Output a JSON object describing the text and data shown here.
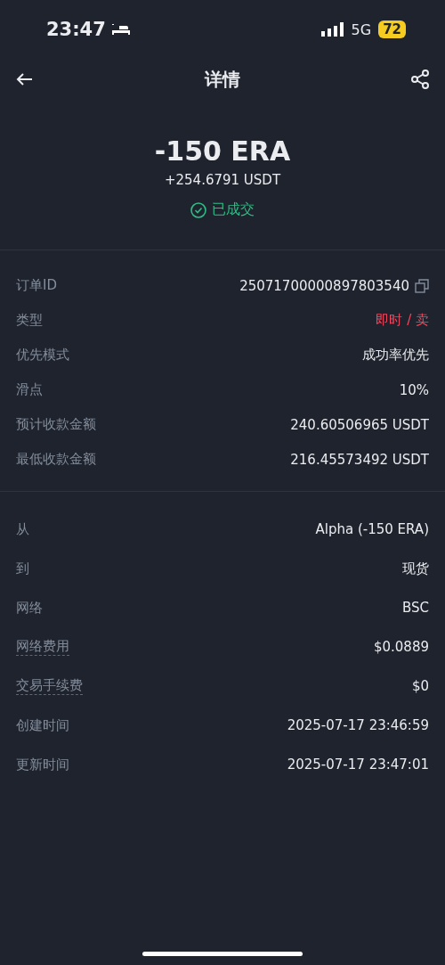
{
  "status_bar": {
    "time": "23:47",
    "network": "5G",
    "battery": "72"
  },
  "header": {
    "title": "详情"
  },
  "summary": {
    "amount": "-150 ERA",
    "received": "+254.6791 USDT",
    "status": "已成交"
  },
  "sections": [
    {
      "rows": [
        {
          "label": "订单ID",
          "value": "25071700000897803540",
          "copyable": true,
          "underlined": false,
          "sell": false
        },
        {
          "label": "类型",
          "value": "即时 / 卖",
          "copyable": false,
          "underlined": false,
          "sell": true
        },
        {
          "label": "优先模式",
          "value": "成功率优先",
          "copyable": false,
          "underlined": false,
          "sell": false
        },
        {
          "label": "滑点",
          "value": "10%",
          "copyable": false,
          "underlined": false,
          "sell": false
        },
        {
          "label": "预计收款金额",
          "value": "240.60506965 USDT",
          "copyable": false,
          "underlined": false,
          "sell": false
        },
        {
          "label": "最低收款金额",
          "value": "216.45573492 USDT",
          "copyable": false,
          "underlined": false,
          "sell": false
        }
      ]
    },
    {
      "rows": [
        {
          "label": "从",
          "value": "Alpha (-150 ERA)",
          "copyable": false,
          "underlined": false,
          "sell": false
        },
        {
          "label": "到",
          "value": "现货",
          "copyable": false,
          "underlined": false,
          "sell": false
        },
        {
          "label": "网络",
          "value": "BSC",
          "copyable": false,
          "underlined": false,
          "sell": false
        },
        {
          "label": "网络费用",
          "value": "$0.0889",
          "copyable": false,
          "underlined": true,
          "sell": false
        },
        {
          "label": "交易手续费",
          "value": "$0",
          "copyable": false,
          "underlined": true,
          "sell": false
        },
        {
          "label": "创建时间",
          "value": "2025-07-17 23:46:59",
          "copyable": false,
          "underlined": false,
          "sell": false
        },
        {
          "label": "更新时间",
          "value": "2025-07-17 23:47:01",
          "copyable": false,
          "underlined": false,
          "sell": false
        }
      ]
    }
  ]
}
